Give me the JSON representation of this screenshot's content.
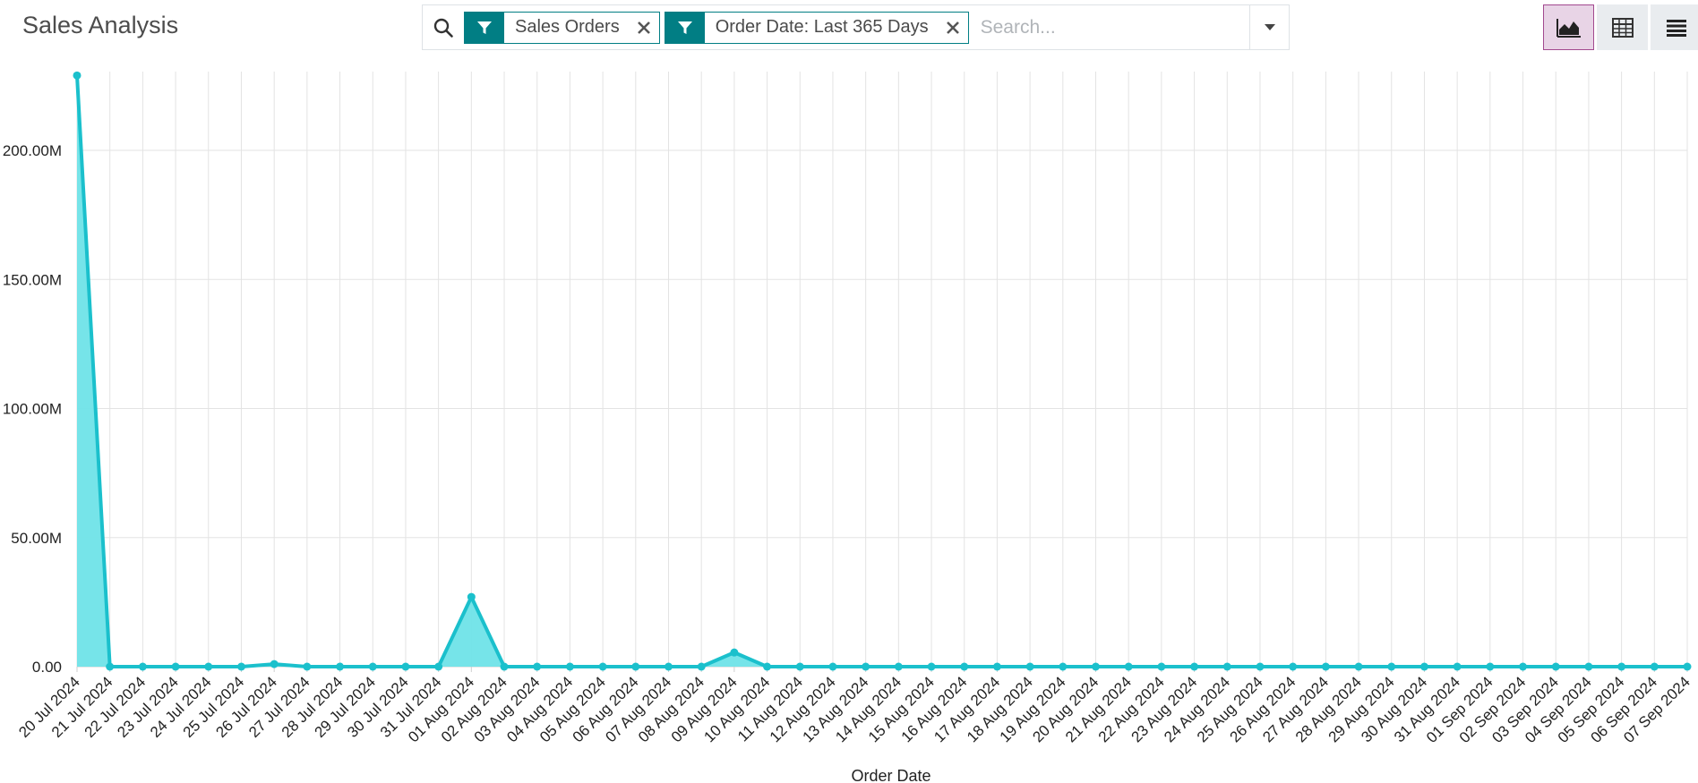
{
  "header": {
    "title": "Sales Analysis"
  },
  "search": {
    "placeholder": "Search...",
    "facets": [
      {
        "label": "Sales Orders"
      },
      {
        "label": "Order Date: Last 365 Days"
      }
    ]
  },
  "icons": {
    "search": "search-icon",
    "filter": "filter-icon",
    "close": "close-icon",
    "dropdown": "caret-down-icon",
    "graph_view": "area-chart-icon",
    "pivot_view": "table-grid-icon",
    "list_view": "list-icon"
  },
  "colors": {
    "accent": "#017e84",
    "line": "#1bc0cc",
    "area": "#6fe3e8",
    "active_view": "#a2498f"
  },
  "chart_data": {
    "type": "area",
    "xlabel": "Order Date",
    "ylabel": "",
    "ylim": [
      0,
      230000000
    ],
    "y_ticks": [
      {
        "value": 0,
        "label": "0.00"
      },
      {
        "value": 50000000,
        "label": "50.00M"
      },
      {
        "value": 100000000,
        "label": "100.00M"
      },
      {
        "value": 150000000,
        "label": "150.00M"
      },
      {
        "value": 200000000,
        "label": "200.00M"
      }
    ],
    "grid": true,
    "categories": [
      "20 Jul 2024",
      "21 Jul 2024",
      "22 Jul 2024",
      "23 Jul 2024",
      "24 Jul 2024",
      "25 Jul 2024",
      "26 Jul 2024",
      "27 Jul 2024",
      "28 Jul 2024",
      "29 Jul 2024",
      "30 Jul 2024",
      "31 Jul 2024",
      "01 Aug 2024",
      "02 Aug 2024",
      "03 Aug 2024",
      "04 Aug 2024",
      "05 Aug 2024",
      "06 Aug 2024",
      "07 Aug 2024",
      "08 Aug 2024",
      "09 Aug 2024",
      "10 Aug 2024",
      "11 Aug 2024",
      "12 Aug 2024",
      "13 Aug 2024",
      "14 Aug 2024",
      "15 Aug 2024",
      "16 Aug 2024",
      "17 Aug 2024",
      "18 Aug 2024",
      "19 Aug 2024",
      "20 Aug 2024",
      "21 Aug 2024",
      "22 Aug 2024",
      "23 Aug 2024",
      "24 Aug 2024",
      "25 Aug 2024",
      "26 Aug 2024",
      "27 Aug 2024",
      "28 Aug 2024",
      "29 Aug 2024",
      "30 Aug 2024",
      "31 Aug 2024",
      "01 Sep 2024",
      "02 Sep 2024",
      "03 Sep 2024",
      "04 Sep 2024",
      "05 Sep 2024",
      "06 Sep 2024",
      "07 Sep 2024"
    ],
    "series": [
      {
        "values": [
          229000000,
          0,
          0,
          0,
          0,
          0,
          1000000,
          0,
          0,
          0,
          0,
          0,
          27000000,
          0,
          0,
          0,
          0,
          0,
          0,
          0,
          5500000,
          0,
          0,
          0,
          0,
          0,
          0,
          0,
          0,
          0,
          0,
          0,
          0,
          0,
          0,
          0,
          0,
          0,
          0,
          0,
          0,
          0,
          0,
          0,
          0,
          0,
          0,
          0,
          0,
          0
        ]
      }
    ]
  }
}
